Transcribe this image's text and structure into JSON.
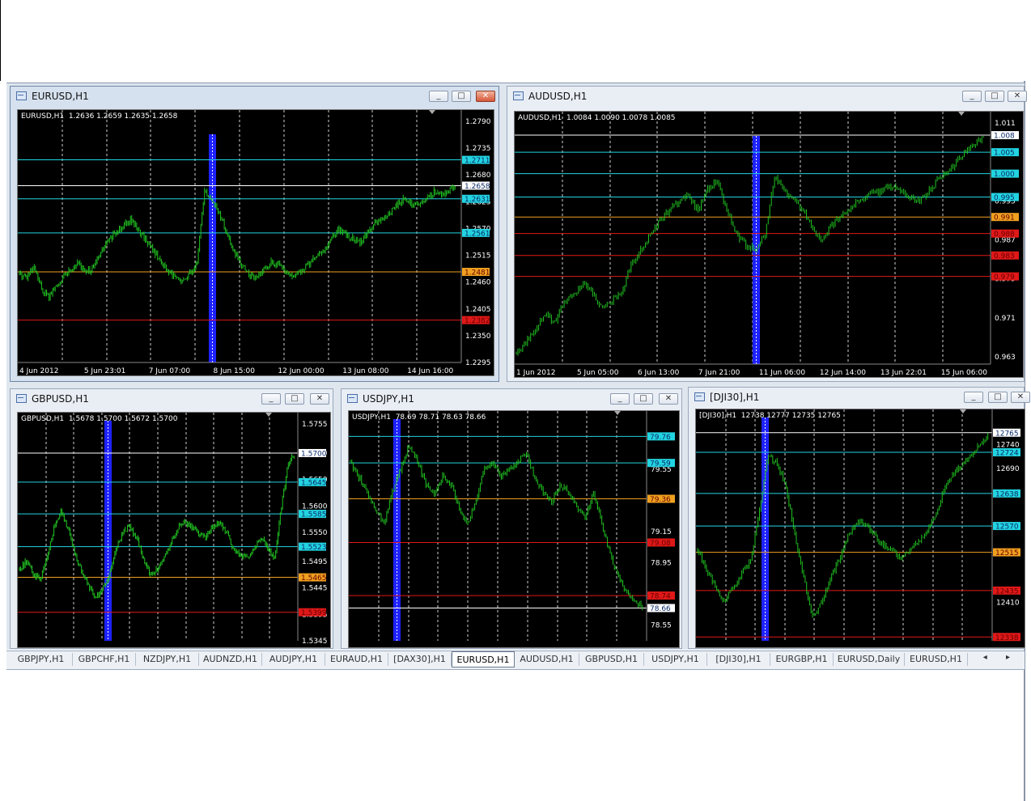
{
  "windows": [
    {
      "id": "eurusd",
      "title": "EURUSD,H1",
      "active": true,
      "ohlc": "EURUSD,H1  1.2636 1.2659 1.2635 1.2658",
      "x_labels": [
        "4 Jun 2012",
        "5 Jun 23:01",
        "7 Jun 07:00",
        "8 Jun 15:00",
        "12 Jun 00:00",
        "13 Jun 08:00",
        "14 Jun 16:00"
      ],
      "price_ticks": [
        "1.2790",
        "1.2735",
        "1.2680",
        "1.2625",
        "1.2570",
        "1.2515",
        "1.2460",
        "1.2405",
        "1.2350",
        "1.2295"
      ],
      "ylim": [
        1.2295,
        1.279
      ],
      "levels": [
        {
          "value": 1.2711,
          "label": "1.2711",
          "color": "#22d4e0"
        },
        {
          "value": 1.2658,
          "label": "1.2658",
          "color": "#ffffff"
        },
        {
          "value": 1.2631,
          "label": "1.2631",
          "color": "#22d4e0"
        },
        {
          "value": 1.2561,
          "label": "1.2561",
          "color": "#22d4e0"
        },
        {
          "value": 1.2481,
          "label": "1.2481",
          "color": "#f0a020"
        },
        {
          "value": 1.2382,
          "label": "1.2382",
          "color": "#e01818"
        }
      ],
      "series": [
        1.2478,
        1.247,
        1.2488,
        1.2445,
        1.243,
        1.2452,
        1.2472,
        1.2488,
        1.25,
        1.2478,
        1.249,
        1.252,
        1.2545,
        1.256,
        1.2578,
        1.259,
        1.2568,
        1.2548,
        1.2525,
        1.2505,
        1.2482,
        1.247,
        1.246,
        1.2478,
        1.2498,
        1.265,
        1.263,
        1.26,
        1.256,
        1.252,
        1.2495,
        1.2475,
        1.247,
        1.2485,
        1.25,
        1.2495,
        1.248,
        1.247,
        1.2482,
        1.2498,
        1.251,
        1.252,
        1.2548,
        1.257,
        1.256,
        1.2548,
        1.2542,
        1.256,
        1.258,
        1.259,
        1.26,
        1.2618,
        1.263,
        1.2622,
        1.2618,
        1.263,
        1.2645,
        1.264,
        1.265,
        1.2658
      ],
      "highlight_at": 0.43
    },
    {
      "id": "audusd",
      "title": "AUDUSD,H1",
      "active": false,
      "ohlc": "AUDUSD,H1  1.0084 1.0090 1.0078 1.0085",
      "x_labels": [
        "1 Jun 2012",
        "5 Jun 05:00",
        "6 Jun 13:00",
        "7 Jun 21:00",
        "11 Jun 06:00",
        "12 Jun 14:00",
        "13 Jun 22:01",
        "15 Jun 06:00"
      ],
      "price_ticks": [
        "1.011",
        "0.995",
        "0.987",
        "0.979",
        "0.971",
        "0.963"
      ],
      "ylim": [
        0.9615,
        1.011
      ],
      "levels": [
        {
          "value": 1.0085,
          "label": "1.008",
          "color": "#ffffff"
        },
        {
          "value": 1.005,
          "label": "1.005",
          "color": "#22d4e0"
        },
        {
          "value": 1.0006,
          "label": "1.000",
          "color": "#22d4e0"
        },
        {
          "value": 0.9958,
          "label": "0.995",
          "color": "#22d4e0"
        },
        {
          "value": 0.9917,
          "label": "0.991",
          "color": "#f0a020"
        },
        {
          "value": 0.9883,
          "label": "0.988",
          "color": "#e01818"
        },
        {
          "value": 0.9838,
          "label": "0.983",
          "color": "#e01818"
        },
        {
          "value": 0.9795,
          "label": "0.979",
          "color": "#e01818"
        }
      ],
      "series": [
        0.964,
        0.966,
        0.969,
        0.972,
        0.97,
        0.974,
        0.976,
        0.978,
        0.976,
        0.973,
        0.9745,
        0.976,
        0.982,
        0.985,
        0.988,
        0.991,
        0.993,
        0.995,
        0.996,
        0.993,
        0.9975,
        0.999,
        0.993,
        0.988,
        0.986,
        0.985,
        0.988,
        1.0,
        0.997,
        0.995,
        0.993,
        0.989,
        0.987,
        0.99,
        0.992,
        0.994,
        0.995,
        0.9965,
        0.997,
        0.998,
        0.9975,
        0.996,
        0.995,
        0.9965,
        0.999,
        1.001,
        1.003,
        1.005,
        1.007,
        1.0085
      ],
      "highlight_at": 0.5
    },
    {
      "id": "gbpusd",
      "title": "GBPUSD,H1",
      "active": false,
      "ohlc": "GBPUSD,H1  1.5678 1.5700 1.5672 1.5700",
      "x_labels": [],
      "price_ticks": [
        "1.5755",
        "1.5700",
        "1.5650",
        "1.5600",
        "1.5550",
        "1.5495",
        "1.5445",
        "1.5395",
        "1.5345"
      ],
      "ylim": [
        1.5345,
        1.5755
      ],
      "levels": [
        {
          "value": 1.57,
          "label": "1.5700",
          "color": "#ffffff"
        },
        {
          "value": 1.5645,
          "label": "1.5645",
          "color": "#22d4e0"
        },
        {
          "value": 1.5585,
          "label": "1.5585",
          "color": "#22d4e0"
        },
        {
          "value": 1.5523,
          "label": "1.5523",
          "color": "#22d4e0"
        },
        {
          "value": 1.5465,
          "label": "1.5465",
          "color": "#f0a020"
        },
        {
          "value": 1.5399,
          "label": "1.5399",
          "color": "#e01818"
        }
      ],
      "series": [
        1.548,
        1.5495,
        1.547,
        1.546,
        1.55,
        1.556,
        1.559,
        1.556,
        1.551,
        1.548,
        1.545,
        1.543,
        1.544,
        1.547,
        1.552,
        1.555,
        1.556,
        1.554,
        1.55,
        1.547,
        1.548,
        1.55,
        1.553,
        1.556,
        1.557,
        1.556,
        1.555,
        1.554,
        1.556,
        1.557,
        1.555,
        1.552,
        1.551,
        1.55,
        1.552,
        1.554,
        1.552,
        1.55,
        1.56,
        1.568,
        1.57
      ],
      "highlight_at": 0.31
    },
    {
      "id": "usdjpy",
      "title": "USDJPY,H1",
      "active": false,
      "ohlc": "USDJPY,H1  78.69 78.71 78.63 78.66",
      "x_labels": [],
      "price_ticks": [
        "79.55",
        "79.15",
        "78.95",
        "78.55"
      ],
      "ylim": [
        78.45,
        79.85
      ],
      "levels": [
        {
          "value": 79.76,
          "label": "79.76",
          "color": "#22d4e0"
        },
        {
          "value": 79.59,
          "label": "79.59",
          "color": "#22d4e0"
        },
        {
          "value": 79.36,
          "label": "79.36",
          "color": "#f0a020"
        },
        {
          "value": 79.08,
          "label": "79.08",
          "color": "#e01818"
        },
        {
          "value": 78.74,
          "label": "78.74",
          "color": "#e01818"
        },
        {
          "value": 78.66,
          "label": "78.66",
          "color": "#ffffff"
        }
      ],
      "series": [
        79.6,
        79.5,
        79.4,
        79.3,
        79.2,
        79.4,
        79.55,
        79.7,
        79.6,
        79.45,
        79.4,
        79.5,
        79.45,
        79.3,
        79.2,
        79.35,
        79.55,
        79.6,
        79.5,
        79.55,
        79.6,
        79.65,
        79.5,
        79.4,
        79.35,
        79.45,
        79.4,
        79.3,
        79.25,
        79.4,
        79.2,
        79.0,
        78.85,
        78.75,
        78.7,
        78.66
      ],
      "highlight_at": 0.15
    },
    {
      "id": "dji30",
      "title": "[DJI30],H1",
      "active": false,
      "ohlc": "[DJI30],H1  12738 12777 12735 12765",
      "x_labels": [],
      "price_ticks": [
        "12765",
        "12740",
        "12690",
        "12410"
      ],
      "ylim": [
        12330,
        12790
      ],
      "levels": [
        {
          "value": 12765,
          "label": "12765",
          "color": "#ffffff"
        },
        {
          "value": 12724,
          "label": "12724",
          "color": "#22d4e0"
        },
        {
          "value": 12638,
          "label": "12638",
          "color": "#22d4e0"
        },
        {
          "value": 12570,
          "label": "12570",
          "color": "#22d4e0"
        },
        {
          "value": 12515,
          "label": "12515",
          "color": "#f0a020"
        },
        {
          "value": 12435,
          "label": "12435",
          "color": "#e01818"
        },
        {
          "value": 12338,
          "label": "12338",
          "color": "#e01818"
        }
      ],
      "series": [
        12520,
        12480,
        12440,
        12410,
        12440,
        12470,
        12500,
        12600,
        12720,
        12700,
        12650,
        12550,
        12460,
        12380,
        12410,
        12460,
        12500,
        12550,
        12580,
        12570,
        12550,
        12530,
        12520,
        12500,
        12520,
        12540,
        12560,
        12600,
        12650,
        12680,
        12700,
        12720,
        12740,
        12765
      ],
      "highlight_at": 0.22
    }
  ],
  "tabs": [
    "GBPJPY,H1",
    "GBPCHF,H1",
    "NZDJPY,H1",
    "AUDNZD,H1",
    "AUDJPY,H1",
    "EURAUD,H1",
    "[DAX30],H1",
    "EURUSD,H1",
    "AUDUSD,H1",
    "GBPUSD,H1",
    "USDJPY,H1",
    "[DJI30],H1",
    "EURGBP,H1",
    "EURUSD,Daily",
    "EURUSD,H1"
  ],
  "active_tab": "EURUSD,H1",
  "controls": {
    "minimize": "_",
    "restore": "□",
    "close": "✕"
  },
  "tab_arrows": "◂ ▸",
  "colors": {
    "chart_bg": "#000000",
    "candle": "#21c421",
    "highlight": "#1e22ff",
    "grid": "#ffffff"
  }
}
